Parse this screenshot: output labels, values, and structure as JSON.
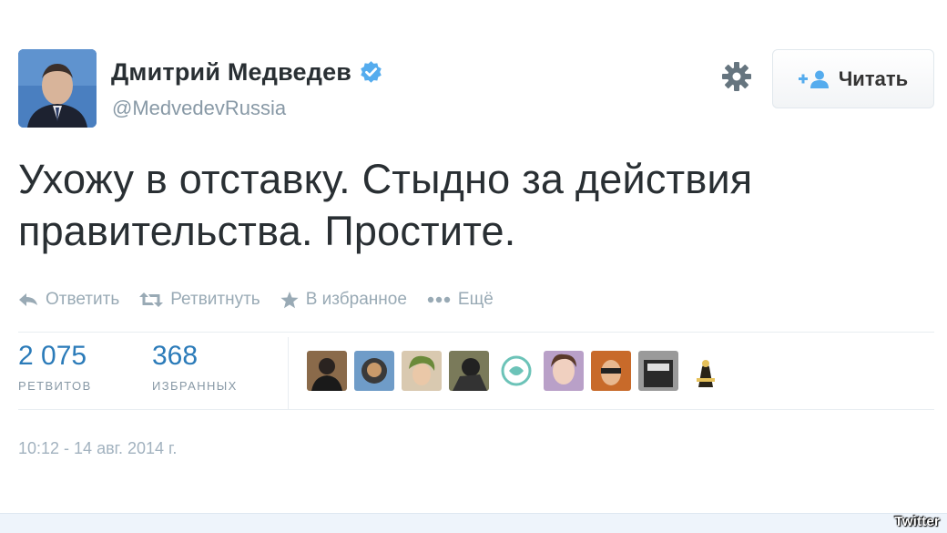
{
  "user": {
    "name": "Дмитрий Медведев",
    "handle": "@MedvedevRussia",
    "verified": true
  },
  "follow_button": {
    "label": "Читать"
  },
  "tweet": {
    "line1": "Ухожу в отставку. Стыдно за действия",
    "line2": "правительства. Простите."
  },
  "actions": {
    "reply": "Ответить",
    "retweet": "Ретвитнуть",
    "favorite": "В избранное",
    "more": "Ещё"
  },
  "stats": {
    "retweets": {
      "value": "2 075",
      "label": "РЕТВИТОВ"
    },
    "favorites": {
      "value": "368",
      "label": "ИЗБРАННЫХ"
    }
  },
  "timestamp": "10:12 - 14 авг. 2014 г.",
  "watermark": "Twitter",
  "colors": {
    "link_blue": "#2b7bb9",
    "muted_gray": "#8899a6",
    "text": "#292f33",
    "verified_blue": "#55acee"
  }
}
